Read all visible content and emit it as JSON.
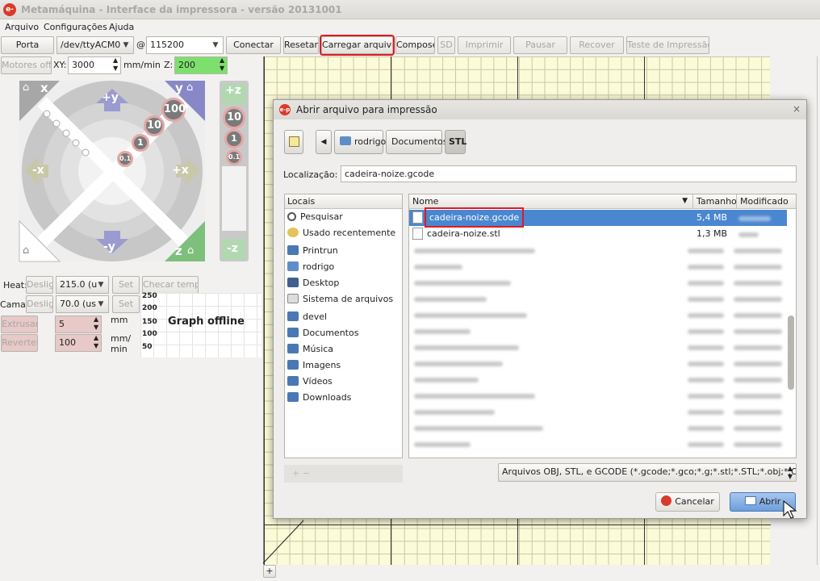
{
  "window": {
    "title": "Metamáquina - Interface da impressora - versão 20131001",
    "logo": "e-p"
  },
  "menu": [
    "Arquivo",
    "Configurações",
    "Ajuda"
  ],
  "toolbar": {
    "porta": "Porta",
    "port_value": "/dev/ttyACM0",
    "at": "@",
    "baud_value": "115200",
    "conectar": "Conectar",
    "resetar": "Resetar",
    "carregar": "Carregar arquivo",
    "compose": "Compose",
    "sd": "SD",
    "imprimir": "Imprimir",
    "pausar": "Pausar",
    "recover": "Recover",
    "teste": "Teste de Impressão"
  },
  "motion": {
    "motores_off": "Motores off",
    "xy_label": "XY:",
    "xy_value": "3000",
    "unit": "mm/min",
    "z_label": "Z:",
    "z_value": "200",
    "labels": {
      "x_home": "x",
      "y_home": "y",
      "z_home": "z",
      "plus_y": "+y",
      "minus_y": "-y",
      "minus_x": "-x",
      "plus_x": "+x",
      "plus_z": "+z",
      "minus_z": "-z"
    },
    "steps": [
      "100",
      "10",
      "1",
      "0.1"
    ],
    "zsteps": [
      "10",
      "1",
      "0.1"
    ]
  },
  "temps": {
    "heat_label": "Heat:",
    "bed_label": "Cama:",
    "off": "Deslig",
    "heat_value": "215.0 (u",
    "bed_value": "70.0 (us",
    "set": "Set",
    "check": "Checar temp",
    "graph_offline": "Graph offline",
    "graph_ticks": [
      "250",
      "200",
      "150",
      "100",
      "50"
    ]
  },
  "extrude": {
    "extrudir": "Extrusar",
    "reverter": "Reverter",
    "length": "5",
    "length_unit": "mm",
    "speed": "100",
    "speed_unit_1": "mm/",
    "speed_unit_2": "min"
  },
  "dialog": {
    "title": "Abrir arquivo para impressão",
    "path": [
      "rodrigo",
      "Documentos",
      "STL"
    ],
    "location_label": "Localização:",
    "location_value": "cadeira-noize.gcode",
    "places_header": "Locais",
    "places": [
      "Pesquisar",
      "Usado recentemente",
      "Printrun",
      "rodrigo",
      "Desktop",
      "Sistema de arquivos",
      "devel",
      "Documentos",
      "Música",
      "Imagens",
      "Vídeos",
      "Downloads"
    ],
    "columns": {
      "name": "Nome",
      "size": "Tamanho",
      "modified": "Modificado"
    },
    "files": [
      {
        "name": "cadeira-noize.gcode",
        "size": "5,4 MB"
      },
      {
        "name": "cadeira-noize.stl",
        "size": "1,3 MB"
      }
    ],
    "filter": "Arquivos OBJ, STL, e GCODE (*.gcode;*.gco;*.g;*.stl;*.STL;*.obj;*.OBJ)",
    "cancel": "Cancelar",
    "open": "Abrir",
    "add_places": "+ −",
    "colors": {
      "selection": "#4a87d0",
      "highlight": "#e01a24"
    }
  },
  "bottom_add": "+"
}
